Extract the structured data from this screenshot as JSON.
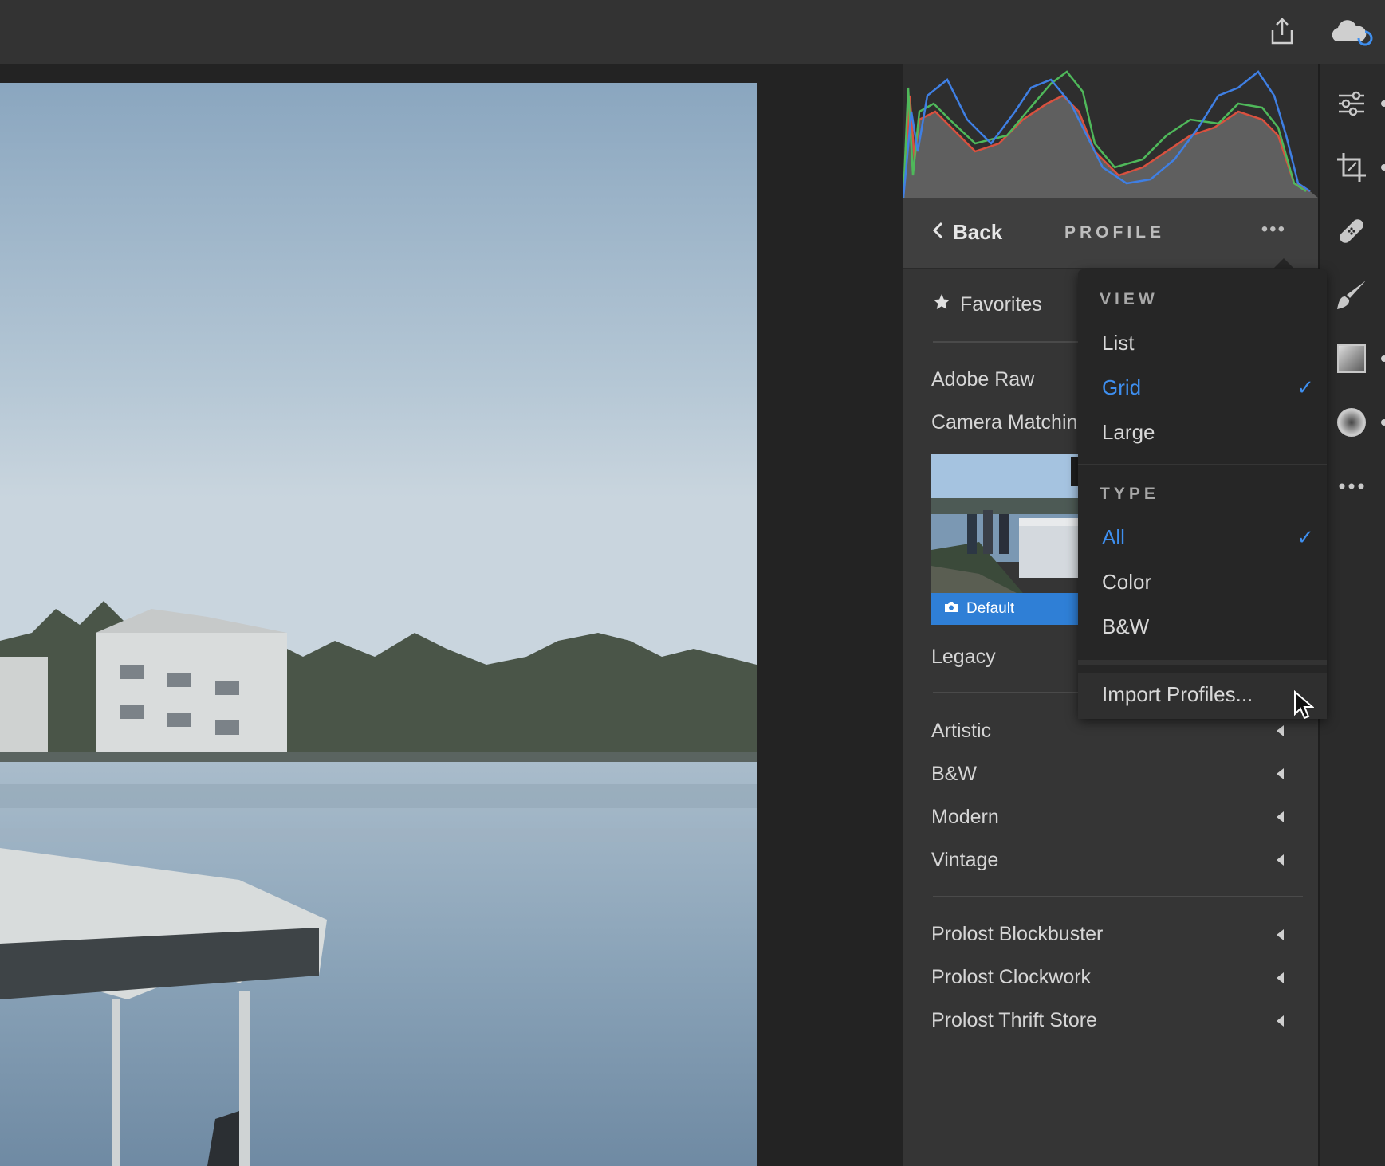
{
  "profile_panel": {
    "back_label": "Back",
    "title": "PROFILE",
    "more_label": "•••"
  },
  "profiles": {
    "favorites_label": "Favorites",
    "group_adobe_raw": "Adobe Raw",
    "group_camera_matching": "Camera Matchin",
    "thumbnail_label": "Default",
    "group_legacy": "Legacy",
    "creative_groups": [
      "Artistic",
      "B&W",
      "Modern",
      "Vintage"
    ],
    "prolost_groups": [
      "Prolost Blockbuster",
      "Prolost Clockwork",
      "Prolost Thrift Store"
    ]
  },
  "menu": {
    "view_heading": "VIEW",
    "view_options": [
      "List",
      "Grid",
      "Large"
    ],
    "view_selected": "Grid",
    "type_heading": "TYPE",
    "type_options": [
      "All",
      "Color",
      "B&W"
    ],
    "type_selected": "All",
    "check_glyph": "✓",
    "import_label": "Import Profiles..."
  },
  "icons": {
    "top_bar": [
      "share-icon",
      "cloud-sync-icon"
    ],
    "tool_strip": [
      "edit-sliders-icon",
      "crop-icon",
      "healing-icon",
      "brush-icon",
      "linear-gradient-icon",
      "radial-gradient-icon",
      "more-icon"
    ]
  },
  "colors": {
    "accent_blue": "#3e8ff0",
    "thumbnail_label_bg": "#2f7fd6",
    "panel_bg": "#353535",
    "menu_bg": "#262626"
  }
}
